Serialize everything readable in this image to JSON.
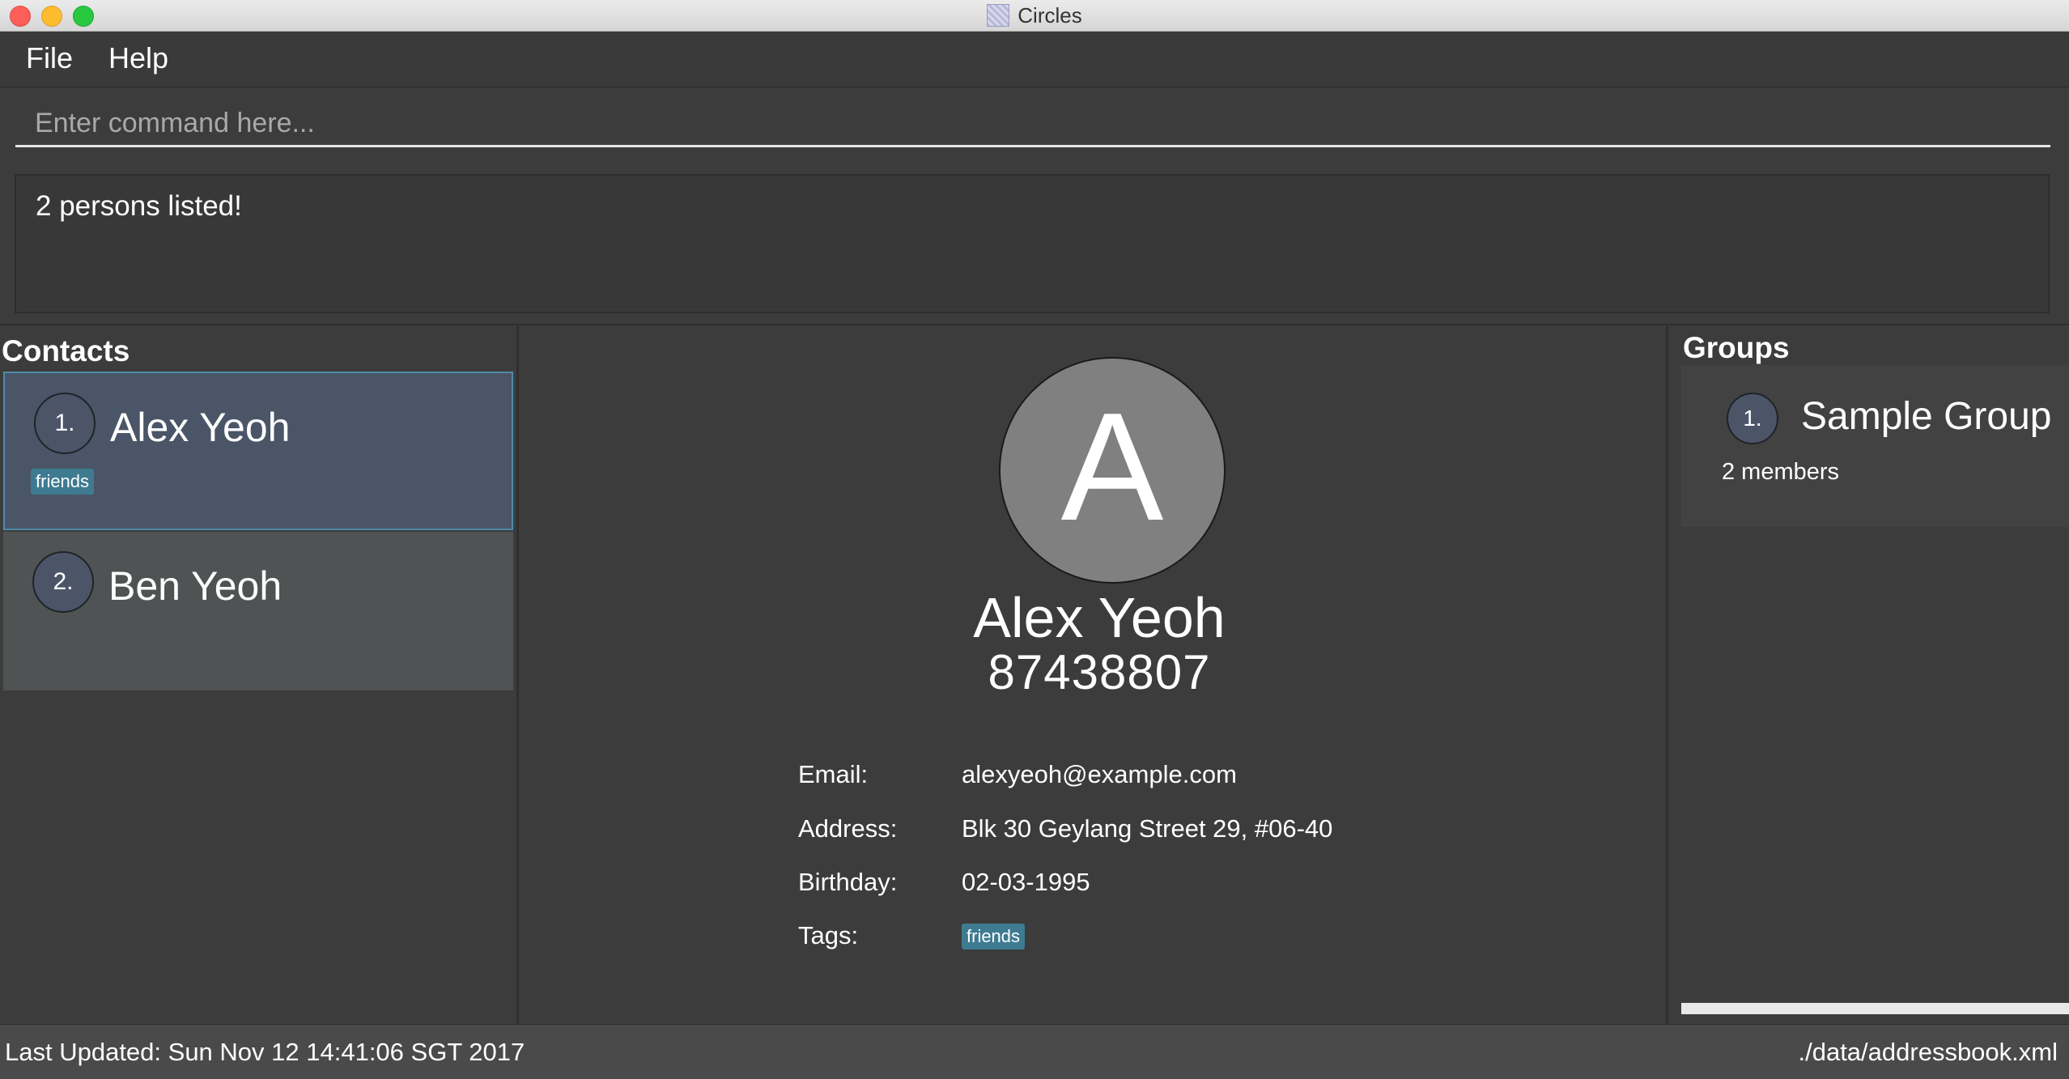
{
  "window": {
    "title": "Circles"
  },
  "menu": {
    "file": "File",
    "help": "Help"
  },
  "command": {
    "placeholder": "Enter command here...",
    "value": ""
  },
  "result": {
    "message": "2 persons listed!"
  },
  "contacts": {
    "heading": "Contacts",
    "items": [
      {
        "index": "1.",
        "name": "Alex Yeoh",
        "tags": [
          "friends"
        ],
        "selected": true
      },
      {
        "index": "2.",
        "name": "Ben Yeoh",
        "tags": [],
        "selected": false
      }
    ]
  },
  "details": {
    "avatar_letter": "A",
    "name": "Alex Yeoh",
    "phone": "87438807",
    "email_label": "Email:",
    "email": "alexyeoh@example.com",
    "address_label": "Address:",
    "address": "Blk 30 Geylang Street 29, #06-40",
    "birthday_label": "Birthday:",
    "birthday": "02-03-1995",
    "tags_label": "Tags:",
    "tags": [
      "friends"
    ]
  },
  "groups": {
    "heading": "Groups",
    "items": [
      {
        "index": "1.",
        "name": "Sample Group",
        "members": "2 members"
      }
    ]
  },
  "status": {
    "last_updated": "Last Updated: Sun Nov 12 14:41:06 SGT 2017",
    "file_path": "./data/addressbook.xml"
  },
  "colors": {
    "background": "#3c3c3c",
    "selected_card": "#4a5567",
    "tag": "#3e7b91",
    "avatar": "#808080"
  }
}
